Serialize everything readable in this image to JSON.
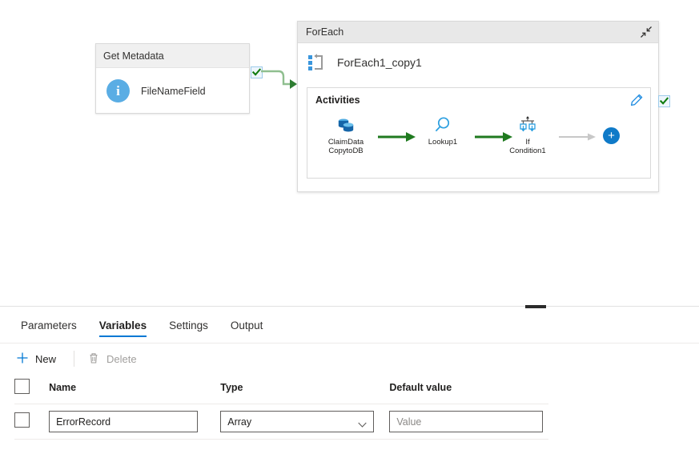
{
  "canvas": {
    "get_metadata": {
      "header": "Get Metadata",
      "icon": "info-icon",
      "label": "FileNameField",
      "status_icon": "green-check-icon"
    },
    "connector": {
      "icon": "green-arrow-connector"
    },
    "foreach": {
      "header": "ForEach",
      "collapse_icon": "collapse-diagonal-arrows-icon",
      "title": "ForEach1_copy1",
      "title_icon": "loop-icon",
      "status_icon": "green-check-icon",
      "activities": {
        "label": "Activities",
        "edit_icon": "pencil-icon",
        "add_label": "+",
        "nodes": [
          {
            "name": "ClaimData\nCopytoDB",
            "line1": "ClaimData",
            "line2": "CopytoDB",
            "icon": "copy-data-icon"
          },
          {
            "name": "Lookup1",
            "line1": "Lookup1",
            "line2": "",
            "icon": "lookup-magnifier-icon"
          },
          {
            "name": "If Condition1",
            "line1": "If",
            "line2": "Condition1",
            "icon": "if-condition-icon"
          }
        ]
      }
    }
  },
  "splitter": {
    "grip": "panel-resize-grip"
  },
  "panel": {
    "tabs": [
      {
        "label": "Parameters",
        "active": false
      },
      {
        "label": "Variables",
        "active": true
      },
      {
        "label": "Settings",
        "active": false
      },
      {
        "label": "Output",
        "active": false
      }
    ],
    "toolbar": {
      "new_label": "New",
      "new_icon": "plus-icon",
      "delete_label": "Delete",
      "delete_icon": "trash-icon"
    },
    "table": {
      "headers": [
        "Name",
        "Type",
        "Default value"
      ],
      "rows": [
        {
          "selected": false,
          "name": "ErrorRecord",
          "type": "Array",
          "default_value": "",
          "default_placeholder": "Value"
        }
      ]
    }
  },
  "colors": {
    "accent": "#0078d4",
    "add_button": "#0f7ac8",
    "arrow_active": "#1f7a1f",
    "arrow_inactive": "#c8c8c8",
    "info_icon": "#5aade4",
    "check": "#107c10",
    "node_header": "#f0f0f0",
    "container_header": "#e8e8e8"
  }
}
